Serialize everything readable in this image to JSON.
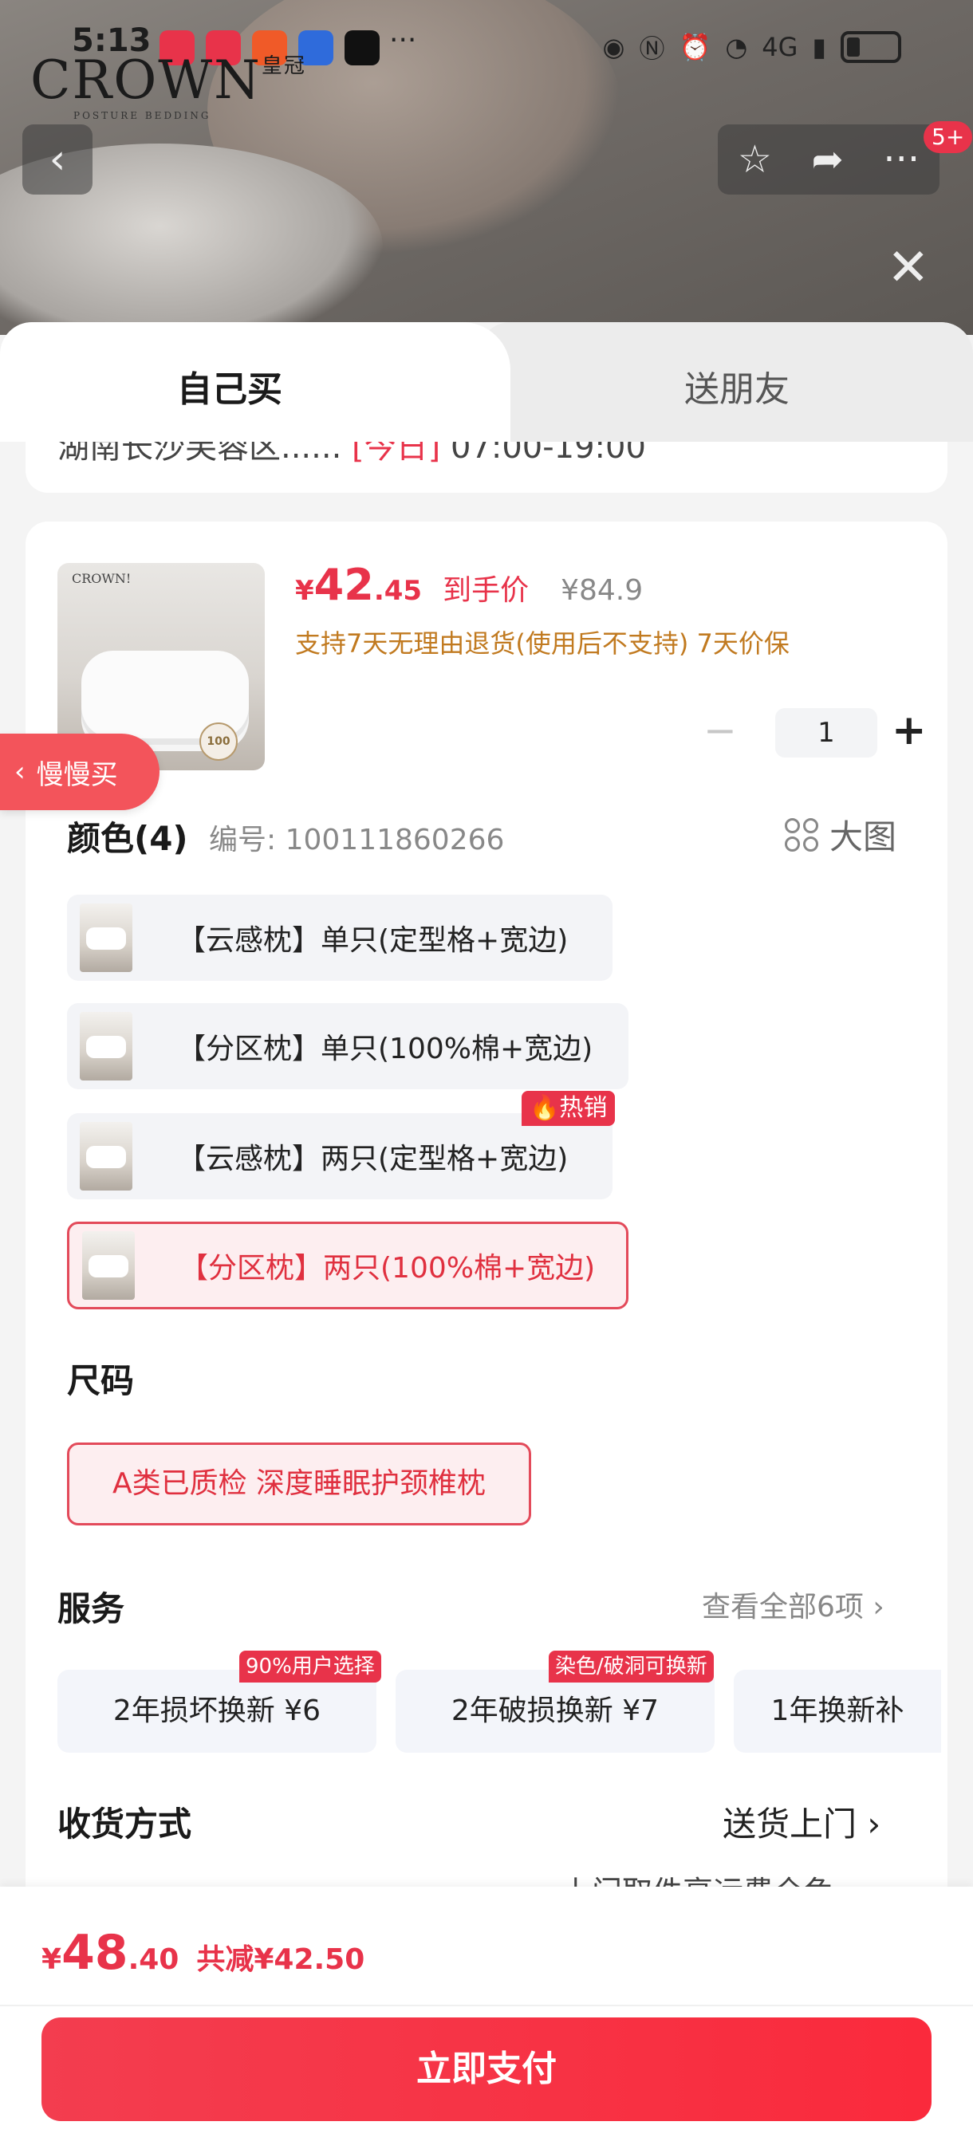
{
  "status_bar": {
    "time": "5:13",
    "more": "···",
    "network": "4G",
    "colors": {
      "huawei": "#e8334a",
      "sina": "#e8334a",
      "slow": "#f05a28",
      "baidu": "#2f6bdb",
      "tiktok": "#111111"
    }
  },
  "brand": {
    "logo": "CROWN",
    "logo_cn": "皇冠",
    "tagline": "POSTURE BEDDING"
  },
  "nav": {
    "badge": "5+"
  },
  "tabs": {
    "self": "自己买",
    "gift": "送朋友"
  },
  "address": {
    "text": "湖南长沙芙蓉区......",
    "highlight": "[今日]",
    "time": "07:00-19:00"
  },
  "product": {
    "currency": "¥",
    "price_int": "42",
    "price_dec": ".45",
    "price_tag": "到手价",
    "orig_price": "¥84.9",
    "return_policy": "支持7天无理由退货(使用后不支持)  7天价保",
    "thumb_logo": "CROWN!",
    "thumb_badge": "100",
    "quantity": "1"
  },
  "slow_buy": {
    "label": "慢慢买"
  },
  "color": {
    "title": "颜色(4)",
    "sku_code": "编号: 100111860266",
    "big_pic": "大图",
    "options": [
      {
        "label": "【云感枕】单只(定型格+宽边)"
      },
      {
        "label": "【分区枕】单只(100%棉+宽边)"
      },
      {
        "label": "【云感枕】两只(定型格+宽边)",
        "badge": "热销"
      },
      {
        "label": "【分区枕】两只(100%棉+宽边)"
      }
    ]
  },
  "size": {
    "title": "尺码",
    "option": "A类已质检 深度睡眠护颈椎枕"
  },
  "service": {
    "title": "服务",
    "view_all": "查看全部6项 ›",
    "items": [
      {
        "label": "2年损坏换新  ¥6",
        "badge": "90%用户选择"
      },
      {
        "label": "2年破损换新  ¥7",
        "badge": "染色/破洞可换新"
      },
      {
        "label": "1年换新补"
      }
    ]
  },
  "delivery": {
    "title": "收货方式",
    "value": "送货上门  ›",
    "note": "上门取件享运费全免"
  },
  "footer": {
    "currency": "¥",
    "total_int": "48",
    "total_dec": ".40",
    "saved": "共减¥42.50",
    "pay": "立即支付"
  }
}
